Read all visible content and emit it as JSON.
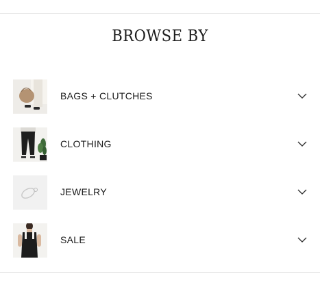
{
  "section": {
    "title": "BROWSE BY"
  },
  "categories": [
    {
      "label": "BAGS + CLUTCHES",
      "icon": "chevron-down-icon"
    },
    {
      "label": "CLOTHING",
      "icon": "chevron-down-icon"
    },
    {
      "label": "JEWELRY",
      "icon": "chevron-down-icon"
    },
    {
      "label": "SALE",
      "icon": "chevron-down-icon"
    }
  ]
}
